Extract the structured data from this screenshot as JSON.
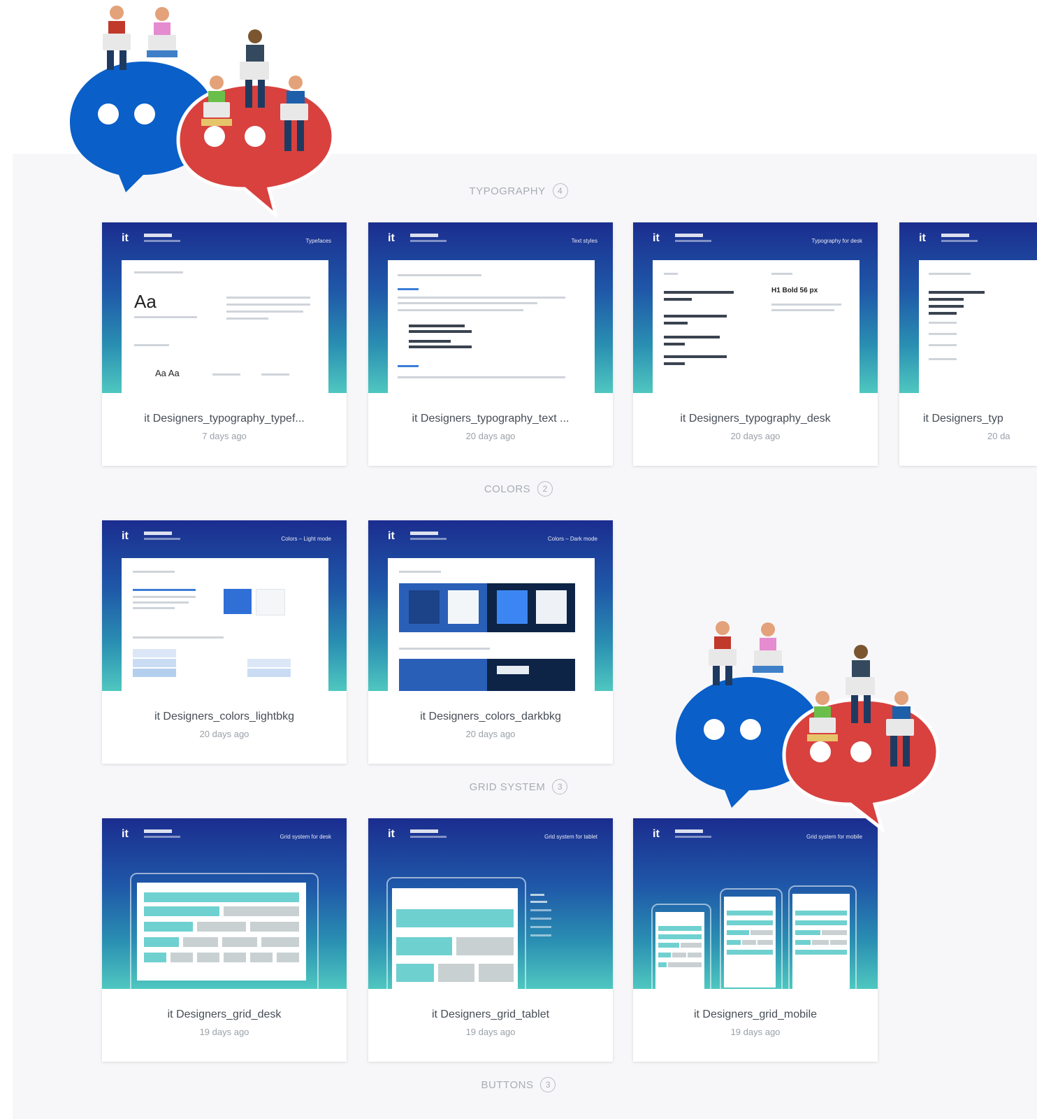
{
  "sections": [
    {
      "title": "TYPOGRAPHY",
      "count": "4"
    },
    {
      "title": "COLORS",
      "count": "2"
    },
    {
      "title": "GRID SYSTEM",
      "count": "3"
    },
    {
      "title": "BUTTONS",
      "count": "3"
    }
  ],
  "cards": {
    "typography": [
      {
        "name": "it Designers_typography_typef...",
        "date": "7 days ago",
        "thumb": "Typefaces"
      },
      {
        "name": "it Designers_typography_text ...",
        "date": "20 days ago",
        "thumb": "Text styles"
      },
      {
        "name": "it Designers_typography_desk",
        "date": "20 days ago",
        "thumb": "Typography for desk"
      },
      {
        "name": "it Designers_typ",
        "date": "20 da",
        "thumb": ""
      }
    ],
    "colors": [
      {
        "name": "it Designers_colors_lightbkg",
        "date": "20 days ago",
        "thumb": "Colors – Light mode"
      },
      {
        "name": "it Designers_colors_darkbkg",
        "date": "20 days ago",
        "thumb": "Colors – Dark mode"
      }
    ],
    "grid": [
      {
        "name": "it Designers_grid_desk",
        "date": "19 days ago",
        "thumb": "Grid system for desk"
      },
      {
        "name": "it Designers_grid_tablet",
        "date": "19 days ago",
        "thumb": "Grid system for tablet"
      },
      {
        "name": "it Designers_grid_mobile",
        "date": "19 days ago",
        "thumb": "Grid system for mobile"
      }
    ]
  },
  "thumb_text": {
    "logo": "it",
    "aa": "Aa",
    "aa_small": "Aa Aa",
    "h1": "H1 Bold 56 px"
  },
  "colors": {
    "blue_bubble": "#0a5fc9",
    "red_bubble": "#d8413e",
    "gradient_top": "#1b2d8f",
    "gradient_bottom": "#4fc7c0"
  }
}
